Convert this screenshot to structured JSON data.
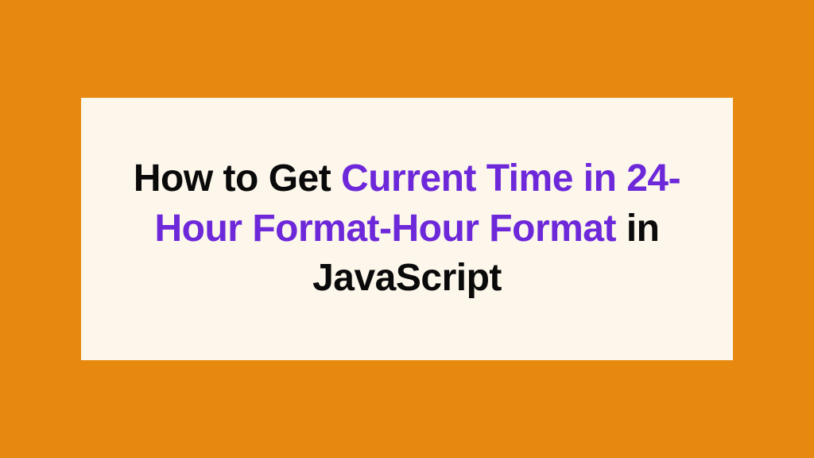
{
  "title": {
    "part1": "How to Get ",
    "part2": "Current Time in 24-Hour Format-Hour Format",
    "part3": " in JavaScript"
  }
}
